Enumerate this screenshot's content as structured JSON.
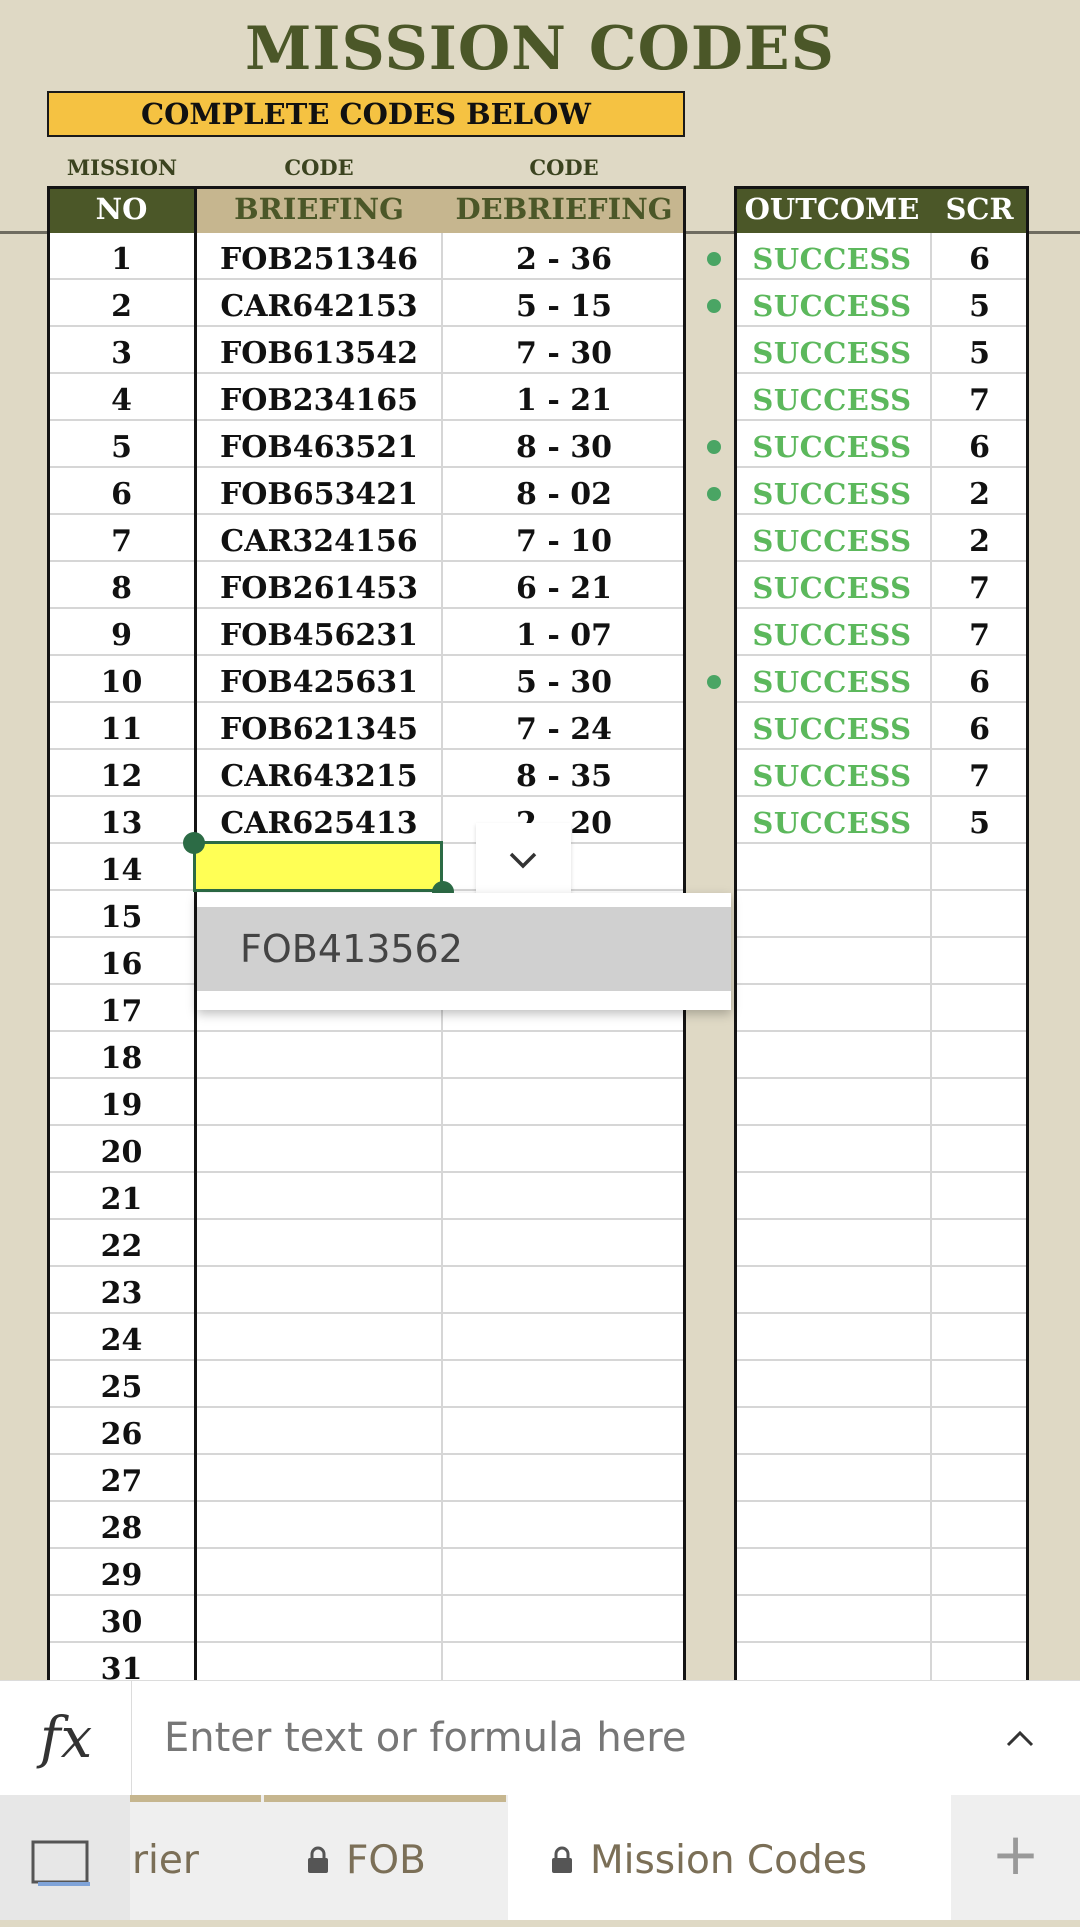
{
  "title": "MISSION CODES",
  "banner": "COMPLETE CODES BELOW",
  "subheaders": {
    "mission": "MISSION",
    "code1": "CODE",
    "code2": "CODE"
  },
  "headers": {
    "no": "NO",
    "briefing": "BRIEFING",
    "debriefing": "DEBRIEFING",
    "outcome": "OUTCOME",
    "scr": "SCR"
  },
  "colors": {
    "olive": "#4b5728",
    "tan": "#c6b68f",
    "banner": "#f5c242",
    "success": "#5cb85c",
    "selected": "#ffff55",
    "bg": "#dfd9c5"
  },
  "rows": [
    {
      "no": "1",
      "briefing": "FOB251346",
      "debriefing": "2 - 36",
      "dot": true,
      "outcome": "SUCCESS",
      "scr": "6"
    },
    {
      "no": "2",
      "briefing": "CAR642153",
      "debriefing": "5 - 15",
      "dot": true,
      "outcome": "SUCCESS",
      "scr": "5"
    },
    {
      "no": "3",
      "briefing": "FOB613542",
      "debriefing": "7 - 30",
      "dot": false,
      "outcome": "SUCCESS",
      "scr": "5"
    },
    {
      "no": "4",
      "briefing": "FOB234165",
      "debriefing": "1 - 21",
      "dot": false,
      "outcome": "SUCCESS",
      "scr": "7"
    },
    {
      "no": "5",
      "briefing": "FOB463521",
      "debriefing": "8 - 30",
      "dot": true,
      "outcome": "SUCCESS",
      "scr": "6"
    },
    {
      "no": "6",
      "briefing": "FOB653421",
      "debriefing": "8 - 02",
      "dot": true,
      "outcome": "SUCCESS",
      "scr": "2"
    },
    {
      "no": "7",
      "briefing": "CAR324156",
      "debriefing": "7 - 10",
      "dot": false,
      "outcome": "SUCCESS",
      "scr": "2"
    },
    {
      "no": "8",
      "briefing": "FOB261453",
      "debriefing": "6 - 21",
      "dot": false,
      "outcome": "SUCCESS",
      "scr": "7"
    },
    {
      "no": "9",
      "briefing": "FOB456231",
      "debriefing": "1 - 07",
      "dot": false,
      "outcome": "SUCCESS",
      "scr": "7"
    },
    {
      "no": "10",
      "briefing": "FOB425631",
      "debriefing": "5 - 30",
      "dot": true,
      "outcome": "SUCCESS",
      "scr": "6"
    },
    {
      "no": "11",
      "briefing": "FOB621345",
      "debriefing": "7 - 24",
      "dot": false,
      "outcome": "SUCCESS",
      "scr": "6"
    },
    {
      "no": "12",
      "briefing": "CAR643215",
      "debriefing": "8 - 35",
      "dot": false,
      "outcome": "SUCCESS",
      "scr": "7"
    },
    {
      "no": "13",
      "briefing": "CAR625413",
      "debriefing": "2 - 20",
      "dot": false,
      "outcome": "SUCCESS",
      "scr": "5"
    },
    {
      "no": "14",
      "briefing": "",
      "debriefing": "",
      "dot": false,
      "outcome": "",
      "scr": ""
    },
    {
      "no": "15",
      "briefing": "",
      "debriefing": "",
      "dot": false,
      "outcome": "",
      "scr": ""
    },
    {
      "no": "16",
      "briefing": "",
      "debriefing": "",
      "dot": false,
      "outcome": "",
      "scr": ""
    },
    {
      "no": "17",
      "briefing": "",
      "debriefing": "",
      "dot": false,
      "outcome": "",
      "scr": ""
    },
    {
      "no": "18",
      "briefing": "",
      "debriefing": "",
      "dot": false,
      "outcome": "",
      "scr": ""
    },
    {
      "no": "19",
      "briefing": "",
      "debriefing": "",
      "dot": false,
      "outcome": "",
      "scr": ""
    },
    {
      "no": "20",
      "briefing": "",
      "debriefing": "",
      "dot": false,
      "outcome": "",
      "scr": ""
    },
    {
      "no": "21",
      "briefing": "",
      "debriefing": "",
      "dot": false,
      "outcome": "",
      "scr": ""
    },
    {
      "no": "22",
      "briefing": "",
      "debriefing": "",
      "dot": false,
      "outcome": "",
      "scr": ""
    },
    {
      "no": "23",
      "briefing": "",
      "debriefing": "",
      "dot": false,
      "outcome": "",
      "scr": ""
    },
    {
      "no": "24",
      "briefing": "",
      "debriefing": "",
      "dot": false,
      "outcome": "",
      "scr": ""
    },
    {
      "no": "25",
      "briefing": "",
      "debriefing": "",
      "dot": false,
      "outcome": "",
      "scr": ""
    },
    {
      "no": "26",
      "briefing": "",
      "debriefing": "",
      "dot": false,
      "outcome": "",
      "scr": ""
    },
    {
      "no": "27",
      "briefing": "",
      "debriefing": "",
      "dot": false,
      "outcome": "",
      "scr": ""
    },
    {
      "no": "28",
      "briefing": "",
      "debriefing": "",
      "dot": false,
      "outcome": "",
      "scr": ""
    },
    {
      "no": "29",
      "briefing": "",
      "debriefing": "",
      "dot": false,
      "outcome": "",
      "scr": ""
    },
    {
      "no": "30",
      "briefing": "",
      "debriefing": "",
      "dot": false,
      "outcome": "",
      "scr": ""
    },
    {
      "no": "31",
      "briefing": "",
      "debriefing": "",
      "dot": false,
      "outcome": "",
      "scr": ""
    }
  ],
  "dropdown": {
    "option": "FOB413562"
  },
  "formula_bar": {
    "fx_label": "fx",
    "placeholder": "Enter text or formula here",
    "expand_icon": "chevron-up-icon"
  },
  "sheet_tabs": [
    {
      "label": "rier",
      "locked": false
    },
    {
      "label": "FOB",
      "locked": true
    },
    {
      "label": "Mission Codes",
      "locked": true,
      "active": true
    }
  ],
  "add_sheet_label": "+",
  "selected_cell": {
    "row": "14",
    "column": "briefing"
  }
}
